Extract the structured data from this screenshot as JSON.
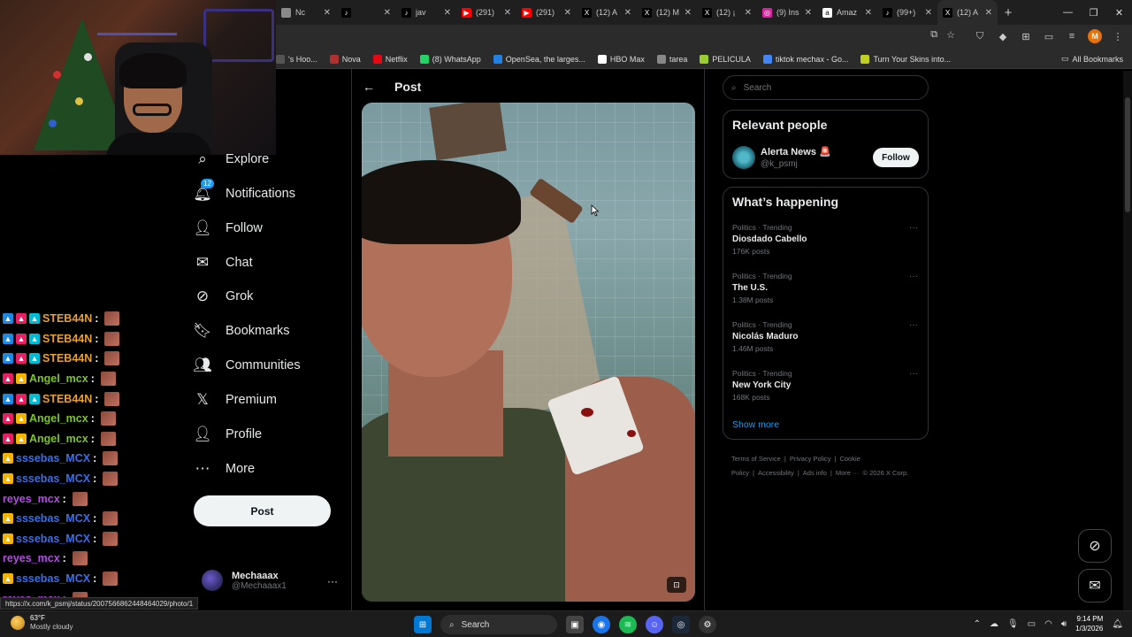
{
  "browser": {
    "tabs": [
      {
        "title": "Nc",
        "fav_color": "#8a8a8a",
        "fav_glyph": "",
        "active": false
      },
      {
        "title": "",
        "fav_color": "#000000",
        "fav_glyph": "♪",
        "active": false
      },
      {
        "title": "jav",
        "fav_color": "#000000",
        "fav_glyph": "♪",
        "active": false
      },
      {
        "title": "(291)",
        "fav_color": "#ff0000",
        "fav_glyph": "▶",
        "active": false
      },
      {
        "title": "(291)",
        "fav_color": "#ff0000",
        "fav_glyph": "▶",
        "active": false
      },
      {
        "title": "(12) A",
        "fav_color": "#000000",
        "fav_glyph": "X",
        "active": false
      },
      {
        "title": "(12) M",
        "fav_color": "#000000",
        "fav_glyph": "X",
        "active": false
      },
      {
        "title": "(12) ¡",
        "fav_color": "#000000",
        "fav_glyph": "X",
        "active": false
      },
      {
        "title": "(9) Ins",
        "fav_color": "#d6249f",
        "fav_glyph": "◎",
        "active": false
      },
      {
        "title": "Amaz",
        "fav_color": "#ffffff",
        "fav_glyph": "a",
        "active": false
      },
      {
        "title": "(99+)",
        "fav_color": "#000000",
        "fav_glyph": "♪",
        "active": false
      },
      {
        "title": "(12) A",
        "fav_color": "#000000",
        "fav_glyph": "X",
        "active": true
      }
    ],
    "new_tab": "+",
    "bookmarks": [
      {
        "label": "'s Hoo...",
        "color": "#555555"
      },
      {
        "label": "Nova",
        "color": "#b03030"
      },
      {
        "label": "Netflix",
        "color": "#e50914"
      },
      {
        "label": "(8) WhatsApp",
        "color": "#25d366"
      },
      {
        "label": "OpenSea, the larges...",
        "color": "#2081e2"
      },
      {
        "label": "HBO Max",
        "color": "#ffffff"
      },
      {
        "label": "tarea",
        "color": "#888888"
      },
      {
        "label": "PELICULA",
        "color": "#9acd32"
      },
      {
        "label": "tiktok mechax - Go...",
        "color": "#4285f4"
      },
      {
        "label": "Turn Your Skins into...",
        "color": "#c0d020"
      }
    ],
    "all_bookmarks": "All Bookmarks",
    "profile_initial": "M",
    "status_url": "https://x.com/k_psmj/status/2007566862448464029/photo/1"
  },
  "chat": {
    "messages": [
      {
        "user": "STEB44N",
        "color": "#e8a030",
        "badges": [
          "#1e88e5",
          "#e91e63",
          "#00bcd4"
        ]
      },
      {
        "user": "STEB44N",
        "color": "#e8a030",
        "badges": [
          "#1e88e5",
          "#e91e63",
          "#00bcd4"
        ]
      },
      {
        "user": "STEB44N",
        "color": "#e8a030",
        "badges": [
          "#1e88e5",
          "#e91e63",
          "#00bcd4"
        ]
      },
      {
        "user": "Angel_mcx",
        "color": "#7cc521",
        "badges": [
          "#e91e63",
          "#f4b400"
        ]
      },
      {
        "user": "STEB44N",
        "color": "#e8a030",
        "badges": [
          "#1e88e5",
          "#e91e63",
          "#00bcd4"
        ]
      },
      {
        "user": "Angel_mcx",
        "color": "#7cc521",
        "badges": [
          "#e91e63",
          "#f4b400"
        ]
      },
      {
        "user": "Angel_mcx",
        "color": "#7cc521",
        "badges": [
          "#e91e63",
          "#f4b400"
        ]
      },
      {
        "user": "sssebas_MCX",
        "color": "#3b6ee6",
        "badges": [
          "#f4b400"
        ]
      },
      {
        "user": "sssebas_MCX",
        "color": "#3b6ee6",
        "badges": [
          "#f4b400"
        ]
      },
      {
        "user": "reyes_mcx",
        "color": "#b44be6",
        "badges": []
      },
      {
        "user": "sssebas_MCX",
        "color": "#3b6ee6",
        "badges": [
          "#f4b400"
        ]
      },
      {
        "user": "sssebas_MCX",
        "color": "#3b6ee6",
        "badges": [
          "#f4b400"
        ]
      },
      {
        "user": "reyes_mcx",
        "color": "#b44be6",
        "badges": []
      },
      {
        "user": "sssebas_MCX",
        "color": "#3b6ee6",
        "badges": [
          "#f4b400"
        ]
      },
      {
        "user": "reyes_mcx",
        "color": "#b44be6",
        "badges": []
      }
    ]
  },
  "nav": {
    "items": [
      {
        "label": "Explore",
        "icon": "search-icon",
        "glyph": "⌕"
      },
      {
        "label": "Notifications",
        "icon": "bell-icon",
        "glyph": "🔔︎",
        "badge": "12"
      },
      {
        "label": "Follow",
        "icon": "add-person-icon",
        "glyph": "👤︎"
      },
      {
        "label": "Chat",
        "icon": "mail-icon",
        "glyph": "✉"
      },
      {
        "label": "Grok",
        "icon": "grok-icon",
        "glyph": "⊘"
      },
      {
        "label": "Bookmarks",
        "icon": "bookmark-icon",
        "glyph": "🔖︎"
      },
      {
        "label": "Communities",
        "icon": "communities-icon",
        "glyph": "👥︎"
      },
      {
        "label": "Premium",
        "icon": "x-logo-icon",
        "glyph": "𝕏"
      },
      {
        "label": "Profile",
        "icon": "profile-icon",
        "glyph": "👤︎"
      },
      {
        "label": "More",
        "icon": "more-circle-icon",
        "glyph": "⋯"
      }
    ],
    "post_button": "Post",
    "account": {
      "name": "Mechaaax",
      "handle": "@Mechaaax1",
      "more": "···"
    }
  },
  "main": {
    "back_glyph": "←",
    "title": "Post"
  },
  "sidebar": {
    "search_placeholder": "Search",
    "relevant": {
      "title": "Relevant people",
      "name": "Alerta News 🚨",
      "handle": "@k_psmj",
      "follow": "Follow"
    },
    "happening": {
      "title": "What’s happening",
      "trends": [
        {
          "meta": "Politics · Trending",
          "name": "Diosdado Cabello",
          "count": "176K posts"
        },
        {
          "meta": "Politics · Trending",
          "name": "The U.S.",
          "count": "1.38M posts"
        },
        {
          "meta": "Politics · Trending",
          "name": "Nicolás Maduro",
          "count": "1.46M posts"
        },
        {
          "meta": "Politics · Trending",
          "name": "New York City",
          "count": "168K posts"
        }
      ],
      "show_more": "Show more"
    },
    "footer": [
      "Terms of Service",
      "|",
      "Privacy Policy",
      "|",
      "Cookie Policy",
      "|",
      "Accessibility",
      "|",
      "Ads info",
      "|",
      "More ···",
      "© 2026 X Corp."
    ]
  },
  "taskbar": {
    "weather_temp": "63°F",
    "weather_desc": "Mostly cloudy",
    "search": "Search",
    "time": "9:14 PM",
    "date": "1/3/2026"
  }
}
